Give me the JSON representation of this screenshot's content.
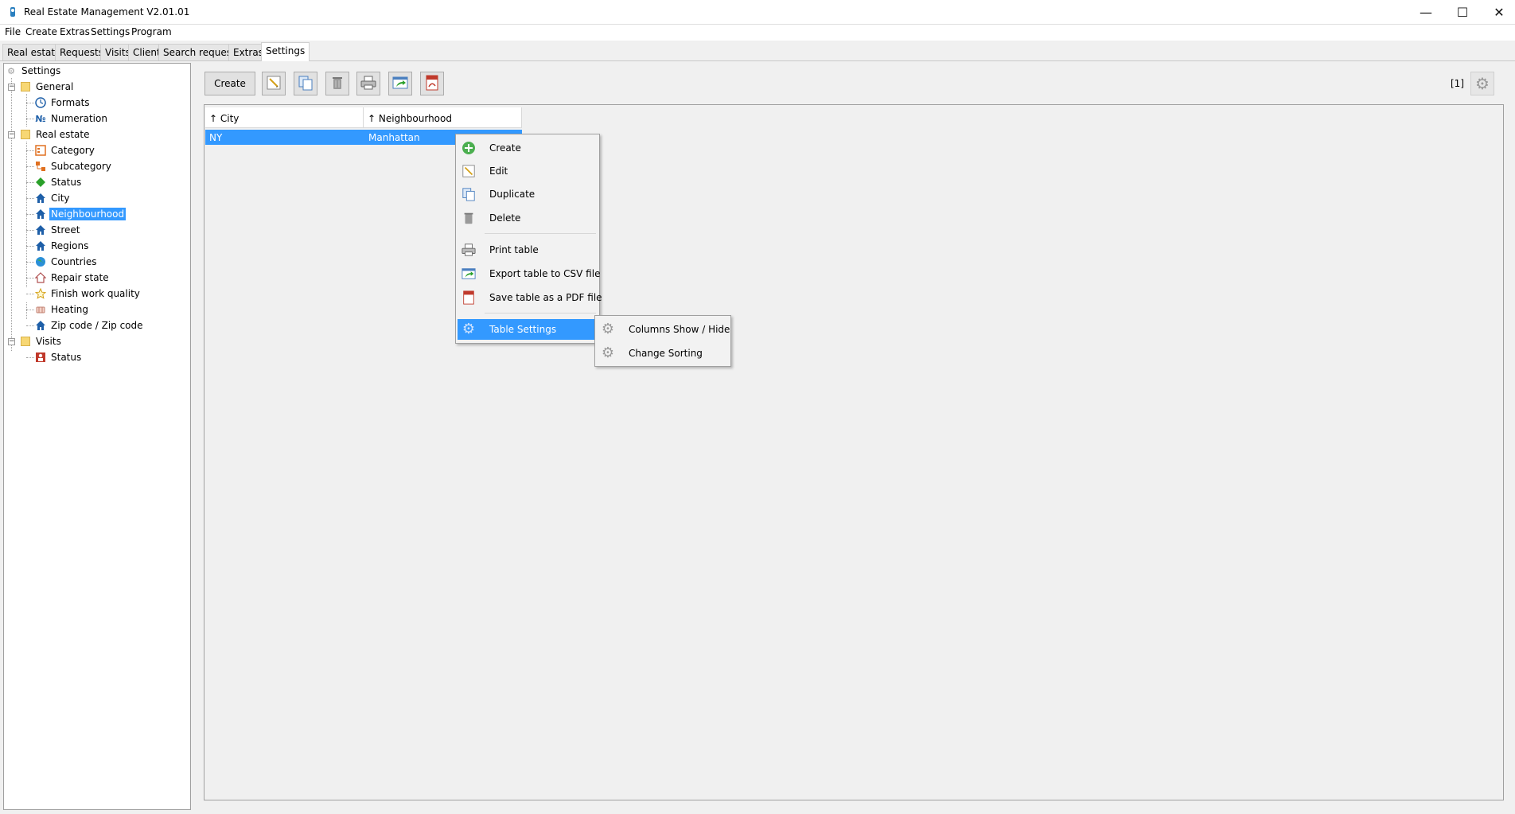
{
  "window": {
    "title": "Real Estate Management V2.01.01",
    "minimize": "—",
    "maximize": "☐",
    "close": "✕"
  },
  "menu": [
    "File",
    "Create",
    "Extras",
    "Settings",
    "Program"
  ],
  "tabs": [
    "Real estate",
    "Requests",
    "Visits",
    "Client",
    "Search requests",
    "Extras",
    "Settings"
  ],
  "tree": {
    "root": "Settings",
    "general": {
      "label": "General",
      "children": [
        "Formats",
        "Numeration"
      ]
    },
    "real_estate": {
      "label": "Real estate",
      "children": [
        "Category",
        "Subcategory",
        "Status",
        "City",
        "Neighbourhood",
        "Street",
        "Regions",
        "Countries",
        "Repair state",
        "Finish work quality",
        "Heating",
        "Zip code / Zip code"
      ]
    },
    "visits": {
      "label": "Visits",
      "children": [
        "Status"
      ]
    },
    "selected": "Neighbourhood",
    "numeration_icon_text": "№"
  },
  "toolbar": {
    "create_label": "Create",
    "counter": "[1]"
  },
  "table": {
    "columns": [
      "↑ City",
      "↑ Neighbourhood"
    ],
    "rows": [
      [
        "NY",
        "Manhattan"
      ]
    ]
  },
  "context_menu": {
    "items": [
      "Create",
      "Edit",
      "Duplicate",
      "Delete",
      "Print table",
      "Export table to CSV file",
      "Save table as a PDF file",
      "Table Settings"
    ],
    "submenu": [
      "Columns Show / Hide",
      "Change Sorting"
    ]
  },
  "colors": {
    "selection": "#3399ff",
    "folder": "#f7d774",
    "house": "#1e5fa8"
  }
}
